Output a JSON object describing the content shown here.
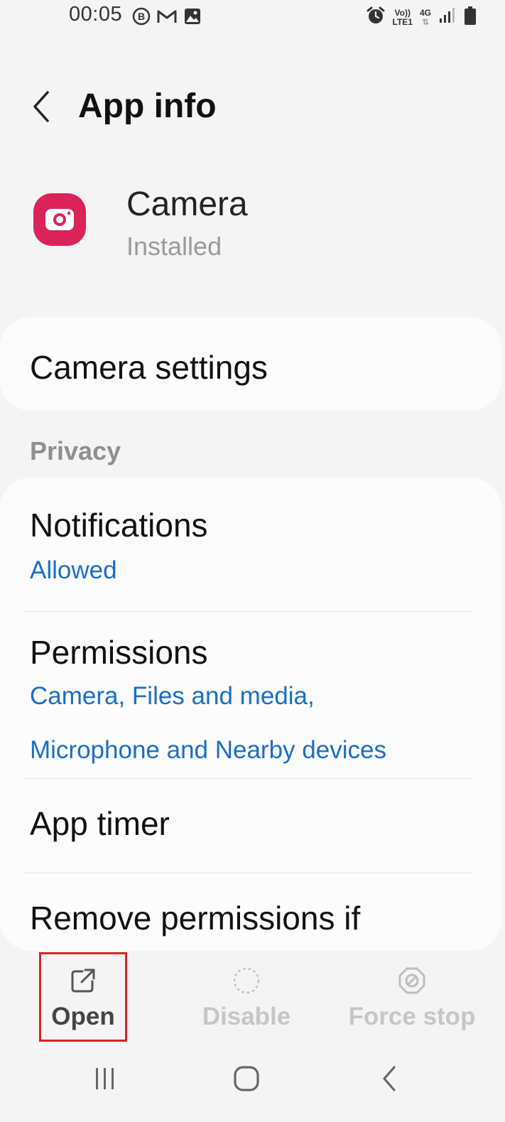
{
  "status_bar": {
    "time": "00:05",
    "icons_left": [
      "b-circle-icon",
      "gmail-icon",
      "gallery-icon"
    ],
    "net_top": "Vo))",
    "net_bottom": "LTE1",
    "net_type": "4G",
    "icons_right": [
      "alarm-icon",
      "signal-icon",
      "battery-icon"
    ]
  },
  "header": {
    "title": "App info"
  },
  "app": {
    "name": "Camera",
    "status": "Installed",
    "icon_color": "#d92359"
  },
  "camera_settings": {
    "label": "Camera settings"
  },
  "privacy": {
    "header": "Privacy",
    "items": [
      {
        "title": "Notifications",
        "subtitle": "Allowed"
      },
      {
        "title": "Permissions",
        "subtitle_line1": "Camera, Files and media,",
        "subtitle_line2": "Microphone and Nearby devices"
      },
      {
        "title": "App timer"
      },
      {
        "title": "Remove permissions if"
      }
    ]
  },
  "actions": {
    "open": "Open",
    "disable": "Disable",
    "force_stop": "Force stop"
  },
  "colors": {
    "accent_link": "#1b6fc4",
    "highlight_box": "#d8222a",
    "disabled_text": "#c6c6c6"
  }
}
